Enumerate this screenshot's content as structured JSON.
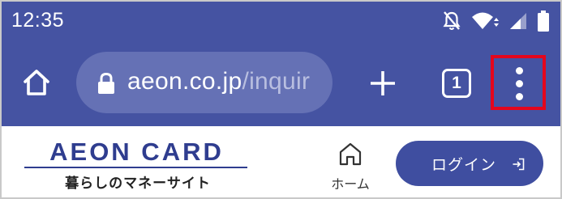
{
  "status_bar": {
    "time": "12:35",
    "icons": [
      "notifications-off-icon",
      "wifi-icon",
      "signal-icon",
      "battery-icon"
    ]
  },
  "toolbar": {
    "url_host": "aeon.co.jp",
    "url_path": "/inquir",
    "tab_count": "1",
    "icons": [
      "home-icon",
      "lock-icon",
      "plus-icon",
      "tabs-icon",
      "more-vert-icon"
    ],
    "highlight_color": "#e4061d",
    "background_color": "#4553a2"
  },
  "page": {
    "logo_title": "AEON CARD",
    "logo_subtitle": "暮らしのマネーサイト",
    "home_label": "ホーム",
    "login_label": "ログイン",
    "brand_color": "#2f3d8f",
    "button_color": "#3f4ea0"
  }
}
